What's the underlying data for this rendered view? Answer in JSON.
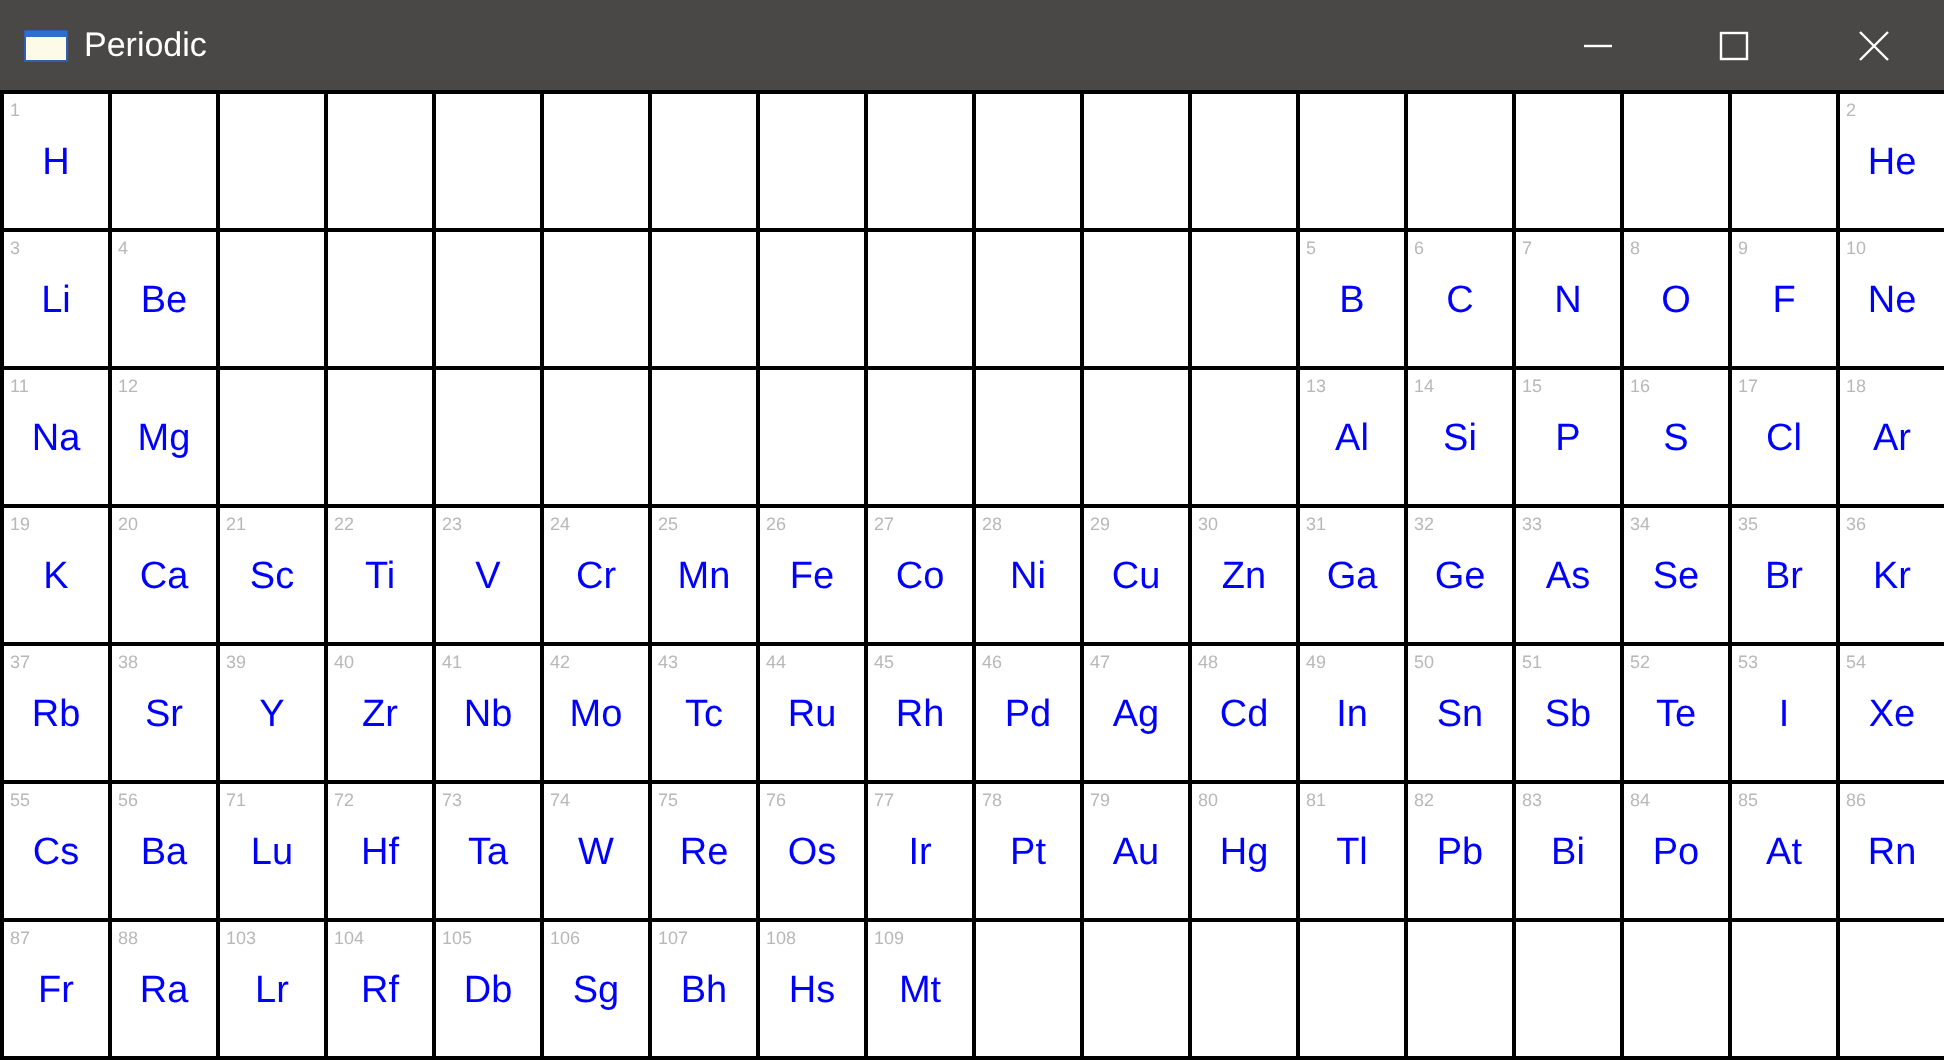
{
  "window": {
    "title": "Periodic"
  },
  "rows": [
    [
      {
        "kind": "element",
        "number": "1",
        "symbol": "H"
      },
      {
        "kind": "empty"
      },
      {
        "kind": "empty"
      },
      {
        "kind": "empty"
      },
      {
        "kind": "empty"
      },
      {
        "kind": "empty"
      },
      {
        "kind": "empty"
      },
      {
        "kind": "empty"
      },
      {
        "kind": "empty"
      },
      {
        "kind": "empty"
      },
      {
        "kind": "empty"
      },
      {
        "kind": "empty"
      },
      {
        "kind": "empty"
      },
      {
        "kind": "empty"
      },
      {
        "kind": "empty"
      },
      {
        "kind": "empty"
      },
      {
        "kind": "empty"
      },
      {
        "kind": "element",
        "number": "2",
        "symbol": "He"
      }
    ],
    [
      {
        "kind": "element",
        "number": "3",
        "symbol": "Li"
      },
      {
        "kind": "element",
        "number": "4",
        "symbol": "Be"
      },
      {
        "kind": "empty"
      },
      {
        "kind": "empty"
      },
      {
        "kind": "empty"
      },
      {
        "kind": "empty"
      },
      {
        "kind": "empty"
      },
      {
        "kind": "empty"
      },
      {
        "kind": "empty"
      },
      {
        "kind": "empty"
      },
      {
        "kind": "empty"
      },
      {
        "kind": "empty"
      },
      {
        "kind": "element",
        "number": "5",
        "symbol": "B"
      },
      {
        "kind": "element",
        "number": "6",
        "symbol": "C"
      },
      {
        "kind": "element",
        "number": "7",
        "symbol": "N"
      },
      {
        "kind": "element",
        "number": "8",
        "symbol": "O"
      },
      {
        "kind": "element",
        "number": "9",
        "symbol": "F"
      },
      {
        "kind": "element",
        "number": "10",
        "symbol": "Ne"
      }
    ],
    [
      {
        "kind": "element",
        "number": "11",
        "symbol": "Na"
      },
      {
        "kind": "element",
        "number": "12",
        "symbol": "Mg"
      },
      {
        "kind": "empty"
      },
      {
        "kind": "empty"
      },
      {
        "kind": "empty"
      },
      {
        "kind": "empty"
      },
      {
        "kind": "empty"
      },
      {
        "kind": "empty"
      },
      {
        "kind": "empty"
      },
      {
        "kind": "empty"
      },
      {
        "kind": "empty"
      },
      {
        "kind": "empty"
      },
      {
        "kind": "element",
        "number": "13",
        "symbol": "Al"
      },
      {
        "kind": "element",
        "number": "14",
        "symbol": "Si"
      },
      {
        "kind": "element",
        "number": "15",
        "symbol": "P"
      },
      {
        "kind": "element",
        "number": "16",
        "symbol": "S"
      },
      {
        "kind": "element",
        "number": "17",
        "symbol": "Cl"
      },
      {
        "kind": "element",
        "number": "18",
        "symbol": "Ar"
      }
    ],
    [
      {
        "kind": "element",
        "number": "19",
        "symbol": "K"
      },
      {
        "kind": "element",
        "number": "20",
        "symbol": "Ca"
      },
      {
        "kind": "element",
        "number": "21",
        "symbol": "Sc"
      },
      {
        "kind": "element",
        "number": "22",
        "symbol": "Ti"
      },
      {
        "kind": "element",
        "number": "23",
        "symbol": "V"
      },
      {
        "kind": "element",
        "number": "24",
        "symbol": "Cr"
      },
      {
        "kind": "element",
        "number": "25",
        "symbol": "Mn"
      },
      {
        "kind": "element",
        "number": "26",
        "symbol": "Fe"
      },
      {
        "kind": "element",
        "number": "27",
        "symbol": "Co"
      },
      {
        "kind": "element",
        "number": "28",
        "symbol": "Ni"
      },
      {
        "kind": "element",
        "number": "29",
        "symbol": "Cu"
      },
      {
        "kind": "element",
        "number": "30",
        "symbol": "Zn"
      },
      {
        "kind": "element",
        "number": "31",
        "symbol": "Ga"
      },
      {
        "kind": "element",
        "number": "32",
        "symbol": "Ge"
      },
      {
        "kind": "element",
        "number": "33",
        "symbol": "As"
      },
      {
        "kind": "element",
        "number": "34",
        "symbol": "Se"
      },
      {
        "kind": "element",
        "number": "35",
        "symbol": "Br"
      },
      {
        "kind": "element",
        "number": "36",
        "symbol": "Kr"
      }
    ],
    [
      {
        "kind": "element",
        "number": "37",
        "symbol": "Rb"
      },
      {
        "kind": "element",
        "number": "38",
        "symbol": "Sr"
      },
      {
        "kind": "element",
        "number": "39",
        "symbol": "Y"
      },
      {
        "kind": "element",
        "number": "40",
        "symbol": "Zr"
      },
      {
        "kind": "element",
        "number": "41",
        "symbol": "Nb"
      },
      {
        "kind": "element",
        "number": "42",
        "symbol": "Mo"
      },
      {
        "kind": "element",
        "number": "43",
        "symbol": "Tc"
      },
      {
        "kind": "element",
        "number": "44",
        "symbol": "Ru"
      },
      {
        "kind": "element",
        "number": "45",
        "symbol": "Rh"
      },
      {
        "kind": "element",
        "number": "46",
        "symbol": "Pd"
      },
      {
        "kind": "element",
        "number": "47",
        "symbol": "Ag"
      },
      {
        "kind": "element",
        "number": "48",
        "symbol": "Cd"
      },
      {
        "kind": "element",
        "number": "49",
        "symbol": "In"
      },
      {
        "kind": "element",
        "number": "50",
        "symbol": "Sn"
      },
      {
        "kind": "element",
        "number": "51",
        "symbol": "Sb"
      },
      {
        "kind": "element",
        "number": "52",
        "symbol": "Te"
      },
      {
        "kind": "element",
        "number": "53",
        "symbol": "I"
      },
      {
        "kind": "element",
        "number": "54",
        "symbol": "Xe"
      }
    ],
    [
      {
        "kind": "element",
        "number": "55",
        "symbol": "Cs"
      },
      {
        "kind": "element",
        "number": "56",
        "symbol": "Ba"
      },
      {
        "kind": "element",
        "number": "71",
        "symbol": "Lu"
      },
      {
        "kind": "element",
        "number": "72",
        "symbol": "Hf"
      },
      {
        "kind": "element",
        "number": "73",
        "symbol": "Ta"
      },
      {
        "kind": "element",
        "number": "74",
        "symbol": "W"
      },
      {
        "kind": "element",
        "number": "75",
        "symbol": "Re"
      },
      {
        "kind": "element",
        "number": "76",
        "symbol": "Os"
      },
      {
        "kind": "element",
        "number": "77",
        "symbol": "Ir"
      },
      {
        "kind": "element",
        "number": "78",
        "symbol": "Pt"
      },
      {
        "kind": "element",
        "number": "79",
        "symbol": "Au"
      },
      {
        "kind": "element",
        "number": "80",
        "symbol": "Hg"
      },
      {
        "kind": "element",
        "number": "81",
        "symbol": "Tl"
      },
      {
        "kind": "element",
        "number": "82",
        "symbol": "Pb"
      },
      {
        "kind": "element",
        "number": "83",
        "symbol": "Bi"
      },
      {
        "kind": "element",
        "number": "84",
        "symbol": "Po"
      },
      {
        "kind": "element",
        "number": "85",
        "symbol": "At"
      },
      {
        "kind": "element",
        "number": "86",
        "symbol": "Rn"
      }
    ],
    [
      {
        "kind": "element",
        "number": "87",
        "symbol": "Fr"
      },
      {
        "kind": "element",
        "number": "88",
        "symbol": "Ra"
      },
      {
        "kind": "element",
        "number": "103",
        "symbol": "Lr"
      },
      {
        "kind": "element",
        "number": "104",
        "symbol": "Rf"
      },
      {
        "kind": "element",
        "number": "105",
        "symbol": "Db"
      },
      {
        "kind": "element",
        "number": "106",
        "symbol": "Sg"
      },
      {
        "kind": "element",
        "number": "107",
        "symbol": "Bh"
      },
      {
        "kind": "element",
        "number": "108",
        "symbol": "Hs"
      },
      {
        "kind": "element",
        "number": "109",
        "symbol": "Mt"
      },
      {
        "kind": "empty"
      },
      {
        "kind": "empty"
      },
      {
        "kind": "empty"
      },
      {
        "kind": "empty"
      },
      {
        "kind": "empty"
      },
      {
        "kind": "empty"
      },
      {
        "kind": "empty"
      },
      {
        "kind": "empty"
      },
      {
        "kind": "empty"
      }
    ]
  ]
}
